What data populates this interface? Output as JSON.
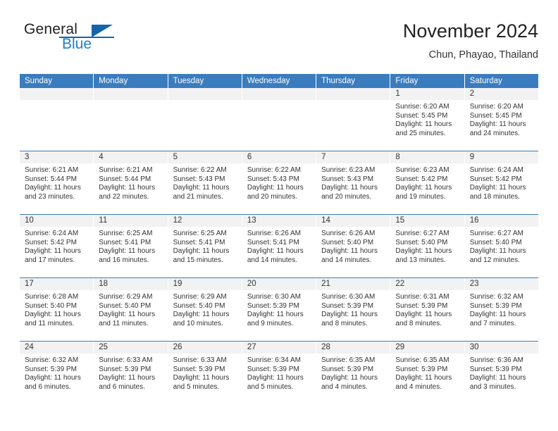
{
  "brand": {
    "line1": "General",
    "line2": "Blue",
    "flag_color": "#1565a8"
  },
  "header": {
    "title": "November 2024",
    "subtitle": "Chun, Phayao, Thailand"
  },
  "colors": {
    "header_blue": "#3a7cbe",
    "daynum_band": "#f2f2f2",
    "text": "#333333"
  },
  "weekdays": [
    "Sunday",
    "Monday",
    "Tuesday",
    "Wednesday",
    "Thursday",
    "Friday",
    "Saturday"
  ],
  "weeks": [
    [
      {
        "day": "",
        "sunrise": "",
        "sunset": "",
        "daylight1": "",
        "daylight2": ""
      },
      {
        "day": "",
        "sunrise": "",
        "sunset": "",
        "daylight1": "",
        "daylight2": ""
      },
      {
        "day": "",
        "sunrise": "",
        "sunset": "",
        "daylight1": "",
        "daylight2": ""
      },
      {
        "day": "",
        "sunrise": "",
        "sunset": "",
        "daylight1": "",
        "daylight2": ""
      },
      {
        "day": "",
        "sunrise": "",
        "sunset": "",
        "daylight1": "",
        "daylight2": ""
      },
      {
        "day": "1",
        "sunrise": "Sunrise: 6:20 AM",
        "sunset": "Sunset: 5:45 PM",
        "daylight1": "Daylight: 11 hours",
        "daylight2": "and 25 minutes."
      },
      {
        "day": "2",
        "sunrise": "Sunrise: 6:20 AM",
        "sunset": "Sunset: 5:45 PM",
        "daylight1": "Daylight: 11 hours",
        "daylight2": "and 24 minutes."
      }
    ],
    [
      {
        "day": "3",
        "sunrise": "Sunrise: 6:21 AM",
        "sunset": "Sunset: 5:44 PM",
        "daylight1": "Daylight: 11 hours",
        "daylight2": "and 23 minutes."
      },
      {
        "day": "4",
        "sunrise": "Sunrise: 6:21 AM",
        "sunset": "Sunset: 5:44 PM",
        "daylight1": "Daylight: 11 hours",
        "daylight2": "and 22 minutes."
      },
      {
        "day": "5",
        "sunrise": "Sunrise: 6:22 AM",
        "sunset": "Sunset: 5:43 PM",
        "daylight1": "Daylight: 11 hours",
        "daylight2": "and 21 minutes."
      },
      {
        "day": "6",
        "sunrise": "Sunrise: 6:22 AM",
        "sunset": "Sunset: 5:43 PM",
        "daylight1": "Daylight: 11 hours",
        "daylight2": "and 20 minutes."
      },
      {
        "day": "7",
        "sunrise": "Sunrise: 6:23 AM",
        "sunset": "Sunset: 5:43 PM",
        "daylight1": "Daylight: 11 hours",
        "daylight2": "and 20 minutes."
      },
      {
        "day": "8",
        "sunrise": "Sunrise: 6:23 AM",
        "sunset": "Sunset: 5:42 PM",
        "daylight1": "Daylight: 11 hours",
        "daylight2": "and 19 minutes."
      },
      {
        "day": "9",
        "sunrise": "Sunrise: 6:24 AM",
        "sunset": "Sunset: 5:42 PM",
        "daylight1": "Daylight: 11 hours",
        "daylight2": "and 18 minutes."
      }
    ],
    [
      {
        "day": "10",
        "sunrise": "Sunrise: 6:24 AM",
        "sunset": "Sunset: 5:42 PM",
        "daylight1": "Daylight: 11 hours",
        "daylight2": "and 17 minutes."
      },
      {
        "day": "11",
        "sunrise": "Sunrise: 6:25 AM",
        "sunset": "Sunset: 5:41 PM",
        "daylight1": "Daylight: 11 hours",
        "daylight2": "and 16 minutes."
      },
      {
        "day": "12",
        "sunrise": "Sunrise: 6:25 AM",
        "sunset": "Sunset: 5:41 PM",
        "daylight1": "Daylight: 11 hours",
        "daylight2": "and 15 minutes."
      },
      {
        "day": "13",
        "sunrise": "Sunrise: 6:26 AM",
        "sunset": "Sunset: 5:41 PM",
        "daylight1": "Daylight: 11 hours",
        "daylight2": "and 14 minutes."
      },
      {
        "day": "14",
        "sunrise": "Sunrise: 6:26 AM",
        "sunset": "Sunset: 5:40 PM",
        "daylight1": "Daylight: 11 hours",
        "daylight2": "and 14 minutes."
      },
      {
        "day": "15",
        "sunrise": "Sunrise: 6:27 AM",
        "sunset": "Sunset: 5:40 PM",
        "daylight1": "Daylight: 11 hours",
        "daylight2": "and 13 minutes."
      },
      {
        "day": "16",
        "sunrise": "Sunrise: 6:27 AM",
        "sunset": "Sunset: 5:40 PM",
        "daylight1": "Daylight: 11 hours",
        "daylight2": "and 12 minutes."
      }
    ],
    [
      {
        "day": "17",
        "sunrise": "Sunrise: 6:28 AM",
        "sunset": "Sunset: 5:40 PM",
        "daylight1": "Daylight: 11 hours",
        "daylight2": "and 11 minutes."
      },
      {
        "day": "18",
        "sunrise": "Sunrise: 6:29 AM",
        "sunset": "Sunset: 5:40 PM",
        "daylight1": "Daylight: 11 hours",
        "daylight2": "and 11 minutes."
      },
      {
        "day": "19",
        "sunrise": "Sunrise: 6:29 AM",
        "sunset": "Sunset: 5:40 PM",
        "daylight1": "Daylight: 11 hours",
        "daylight2": "and 10 minutes."
      },
      {
        "day": "20",
        "sunrise": "Sunrise: 6:30 AM",
        "sunset": "Sunset: 5:39 PM",
        "daylight1": "Daylight: 11 hours",
        "daylight2": "and 9 minutes."
      },
      {
        "day": "21",
        "sunrise": "Sunrise: 6:30 AM",
        "sunset": "Sunset: 5:39 PM",
        "daylight1": "Daylight: 11 hours",
        "daylight2": "and 8 minutes."
      },
      {
        "day": "22",
        "sunrise": "Sunrise: 6:31 AM",
        "sunset": "Sunset: 5:39 PM",
        "daylight1": "Daylight: 11 hours",
        "daylight2": "and 8 minutes."
      },
      {
        "day": "23",
        "sunrise": "Sunrise: 6:32 AM",
        "sunset": "Sunset: 5:39 PM",
        "daylight1": "Daylight: 11 hours",
        "daylight2": "and 7 minutes."
      }
    ],
    [
      {
        "day": "24",
        "sunrise": "Sunrise: 6:32 AM",
        "sunset": "Sunset: 5:39 PM",
        "daylight1": "Daylight: 11 hours",
        "daylight2": "and 6 minutes."
      },
      {
        "day": "25",
        "sunrise": "Sunrise: 6:33 AM",
        "sunset": "Sunset: 5:39 PM",
        "daylight1": "Daylight: 11 hours",
        "daylight2": "and 6 minutes."
      },
      {
        "day": "26",
        "sunrise": "Sunrise: 6:33 AM",
        "sunset": "Sunset: 5:39 PM",
        "daylight1": "Daylight: 11 hours",
        "daylight2": "and 5 minutes."
      },
      {
        "day": "27",
        "sunrise": "Sunrise: 6:34 AM",
        "sunset": "Sunset: 5:39 PM",
        "daylight1": "Daylight: 11 hours",
        "daylight2": "and 5 minutes."
      },
      {
        "day": "28",
        "sunrise": "Sunrise: 6:35 AM",
        "sunset": "Sunset: 5:39 PM",
        "daylight1": "Daylight: 11 hours",
        "daylight2": "and 4 minutes."
      },
      {
        "day": "29",
        "sunrise": "Sunrise: 6:35 AM",
        "sunset": "Sunset: 5:39 PM",
        "daylight1": "Daylight: 11 hours",
        "daylight2": "and 4 minutes."
      },
      {
        "day": "30",
        "sunrise": "Sunrise: 6:36 AM",
        "sunset": "Sunset: 5:39 PM",
        "daylight1": "Daylight: 11 hours",
        "daylight2": "and 3 minutes."
      }
    ]
  ]
}
